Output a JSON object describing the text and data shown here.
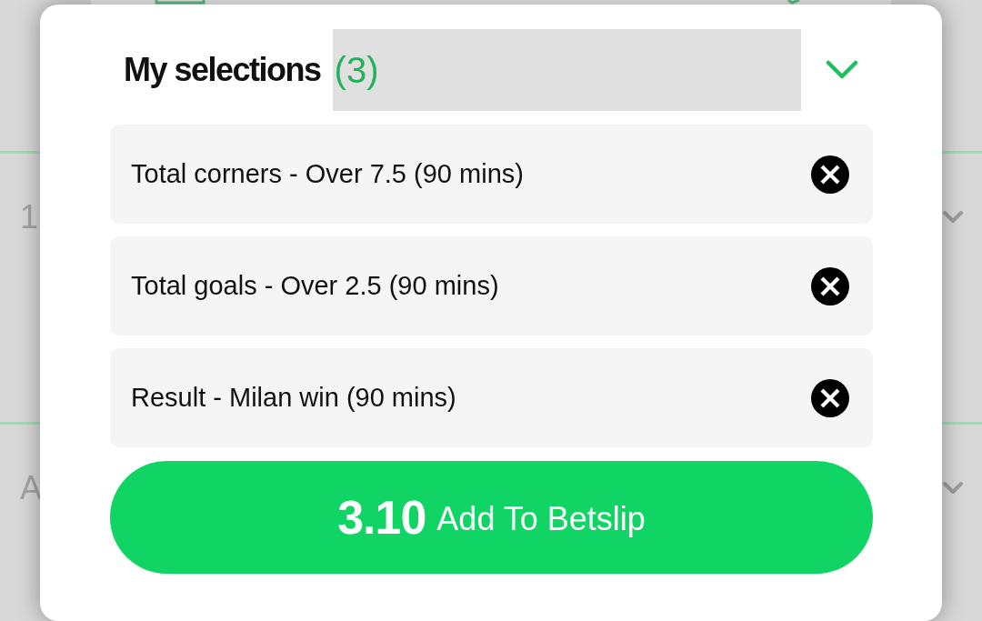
{
  "background": {
    "rows": [
      {
        "label": "1"
      },
      {
        "label": "A"
      }
    ]
  },
  "selections_panel": {
    "title": "My selections",
    "count": "(3)",
    "selections": [
      {
        "label": "Total corners - Over 7.5 (90 mins)"
      },
      {
        "label": "Total goals - Over 2.5 (90 mins)"
      },
      {
        "label": "Result - Milan win (90 mins)"
      }
    ],
    "add_button": {
      "odds": "3.10",
      "label": "Add To Betslip"
    }
  }
}
